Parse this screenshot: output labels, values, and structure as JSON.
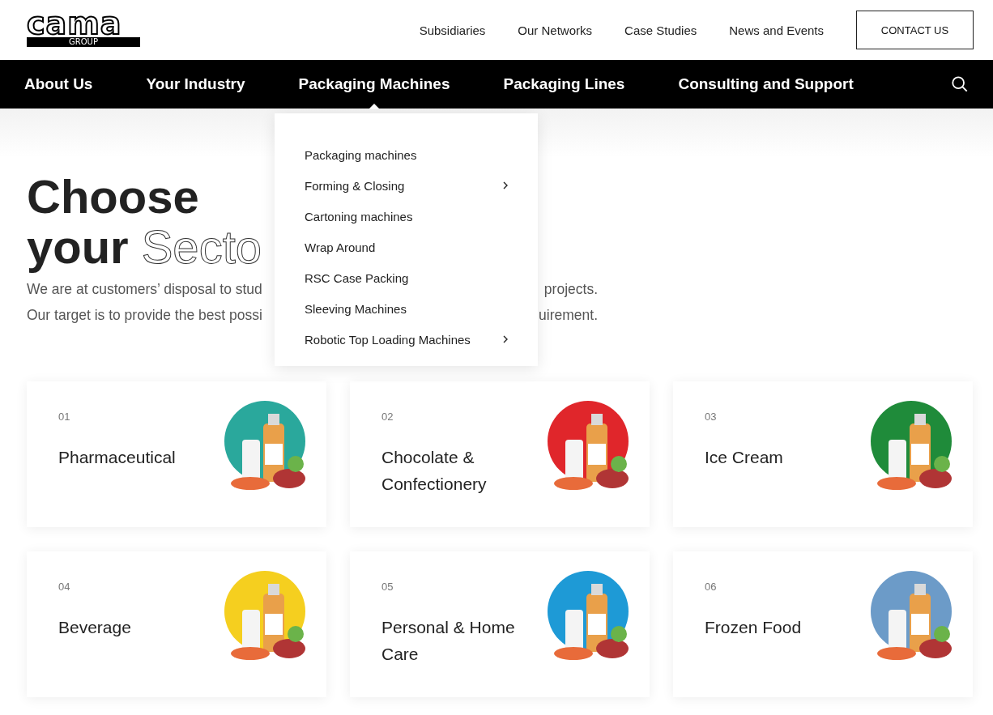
{
  "logo": {
    "name": "cama",
    "sub": "GROUP"
  },
  "top_links": [
    "Subsidiaries",
    "Our Networks",
    "Case Studies",
    "News and Events"
  ],
  "contact_button": "CONTACT US",
  "nav": [
    {
      "label": "About Us",
      "selected": false
    },
    {
      "label": "Your Industry",
      "selected": false
    },
    {
      "label": "Packaging Machines",
      "selected": true
    },
    {
      "label": "Packaging Lines",
      "selected": false
    },
    {
      "label": "Consulting and Support",
      "selected": false
    }
  ],
  "dropdown": [
    {
      "label": "Packaging machines",
      "has_submenu": false
    },
    {
      "label": "Forming & Closing",
      "has_submenu": true
    },
    {
      "label": "Cartoning machines",
      "has_submenu": false
    },
    {
      "label": "Wrap Around",
      "has_submenu": false
    },
    {
      "label": "RSC Case Packing",
      "has_submenu": false
    },
    {
      "label": "Sleeving Machines",
      "has_submenu": false
    },
    {
      "label": "Robotic Top Loading Machines",
      "has_submenu": true
    }
  ],
  "heading": {
    "line1": "Choose",
    "line2_solid": "your",
    "line2_outline": "Secto"
  },
  "intro": [
    {
      "left": "We are at customers’ disposal to stud",
      "right": "projects."
    },
    {
      "left": "Our target is to provide the best possi",
      "right": "uirement."
    }
  ],
  "sectors": [
    {
      "number": "01",
      "title": "Pharmaceutical",
      "color": "#2aa89c"
    },
    {
      "number": "02",
      "title": "Chocolate & Confectionery",
      "color": "#e0262b"
    },
    {
      "number": "03",
      "title": "Ice Cream",
      "color": "#1f8b3a"
    },
    {
      "number": "04",
      "title": "Beverage",
      "color": "#f5cf1f"
    },
    {
      "number": "05",
      "title": "Personal & Home Care",
      "color": "#1e9ad6"
    },
    {
      "number": "06",
      "title": "Frozen Food",
      "color": "#6c9bc8"
    }
  ]
}
